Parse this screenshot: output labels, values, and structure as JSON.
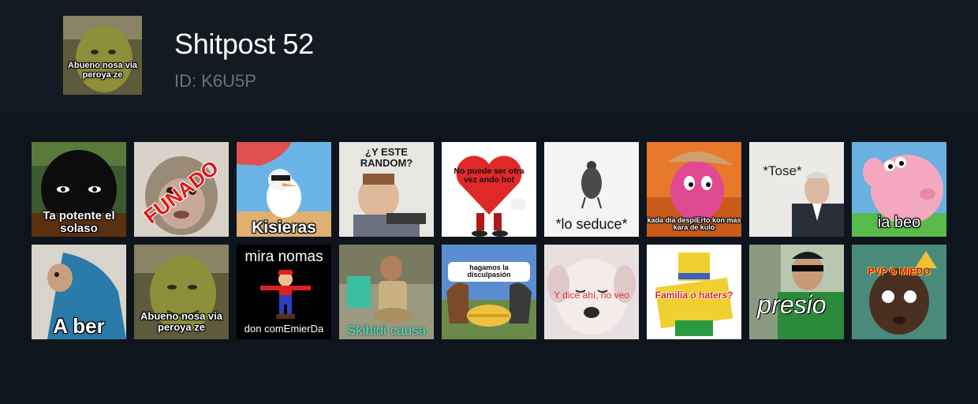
{
  "pack": {
    "title": "Shitpost 52",
    "id_label": "ID: K6U5P",
    "thumb_caption": "Abueno nosa via peroya ze"
  },
  "colors": {
    "page_bg": "#0f151d",
    "header_bg": "#131a22",
    "title": "#ffffff",
    "id_text": "#6c737d"
  },
  "stickers_row1": [
    {
      "caption": "Ta potente el solaso",
      "depicts": "masked-face"
    },
    {
      "caption": "FUNADO",
      "depicts": "monkey"
    },
    {
      "caption": "Kisieras",
      "depicts": "snowman-sunbathing"
    },
    {
      "caption": "¿Y ESTE RANDOM?",
      "depicts": "boy-at-computer"
    },
    {
      "caption": "No puede ser otra vez ando hot",
      "depicts": "red-heart-character"
    },
    {
      "caption": "*lo seduce*",
      "depicts": "pigeon"
    },
    {
      "caption": "kada dia despiErto kon mas kara de kulo",
      "depicts": "pink-character-with-hat"
    },
    {
      "caption": "*Tose*",
      "depicts": "old-man"
    },
    {
      "caption": "ia beo",
      "depicts": "pink-pig"
    }
  ],
  "stickers_row2": [
    {
      "caption": "A ber",
      "depicts": "dog-in-blanket"
    },
    {
      "caption": "Abueno nosa via peroya ze",
      "depicts": "ogre"
    },
    {
      "caption": "mira nomas",
      "caption2": "don comEmierDa",
      "depicts": "plumber-figure"
    },
    {
      "caption": "Skibidi causa",
      "depicts": "head-in-toilet"
    },
    {
      "caption": "hagamos la disculpasión",
      "depicts": "horses-handshake"
    },
    {
      "caption": "Y dice ahí, no veo",
      "depicts": "puppy"
    },
    {
      "caption": "Familia o haters?",
      "depicts": "blocky-avatar"
    },
    {
      "caption": "presio",
      "depicts": "boy-sunglasses"
    },
    {
      "caption": "PVP O MIEDO",
      "depicts": "baby-face"
    }
  ]
}
